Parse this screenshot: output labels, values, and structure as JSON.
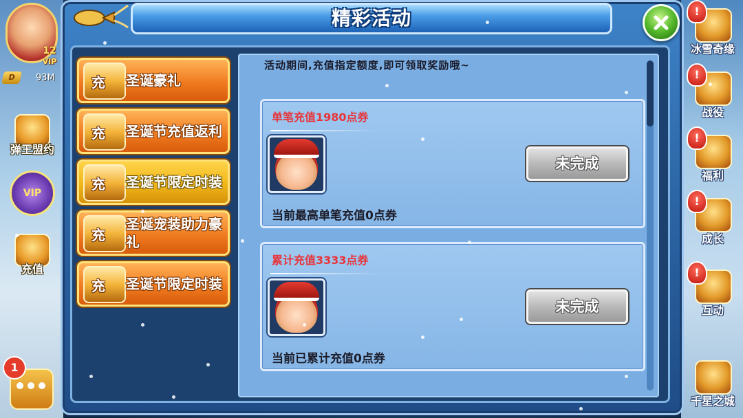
{
  "window": {
    "title": "精彩活动"
  },
  "player": {
    "vip_level": "12",
    "vip_label": "VIP",
    "diamond_icon": "D",
    "currency": "93M"
  },
  "left_menu": [
    {
      "label": "弹王盟约",
      "icon": "scroll-icon"
    },
    {
      "label": "VIP",
      "icon": "vip-wings-icon"
    },
    {
      "label": "充值",
      "icon": "treasure-chest-icon"
    }
  ],
  "chat": {
    "badge": "1"
  },
  "right_menu": [
    {
      "label": "冰雪奇缘",
      "alert": "!"
    },
    {
      "label": "战役",
      "alert": "!"
    },
    {
      "label": "福利",
      "alert": "!"
    },
    {
      "label": "成长",
      "alert": "!"
    },
    {
      "label": "互动",
      "alert": "!"
    },
    {
      "label": "千星之城",
      "alert": ""
    }
  ],
  "tabs": [
    {
      "chest_label": "充",
      "label": "圣诞豪礼",
      "active": false
    },
    {
      "chest_label": "充",
      "label": "圣诞节充值返利",
      "active": false
    },
    {
      "chest_label": "充",
      "label": "圣诞节限定时装",
      "active": true
    },
    {
      "chest_label": "充",
      "label": "圣诞宠装助力豪礼",
      "active": false
    },
    {
      "chest_label": "充",
      "label": "圣诞节限定时装",
      "active": false
    }
  ],
  "content": {
    "description": "活动期间,充值指定额度,即可领取奖励哦~",
    "cards": [
      {
        "title": "单笔充值1980点券",
        "button": "未完成",
        "status": "当前最高单笔充值0点券"
      },
      {
        "title": "累计充值3333点券",
        "button": "未完成",
        "status": "当前已累计充值0点券"
      }
    ]
  },
  "colors": {
    "accent_red": "#e8343a",
    "tab_orange": "#f07b1f",
    "tab_active": "#f0b71a",
    "close_green": "#55b82a"
  }
}
